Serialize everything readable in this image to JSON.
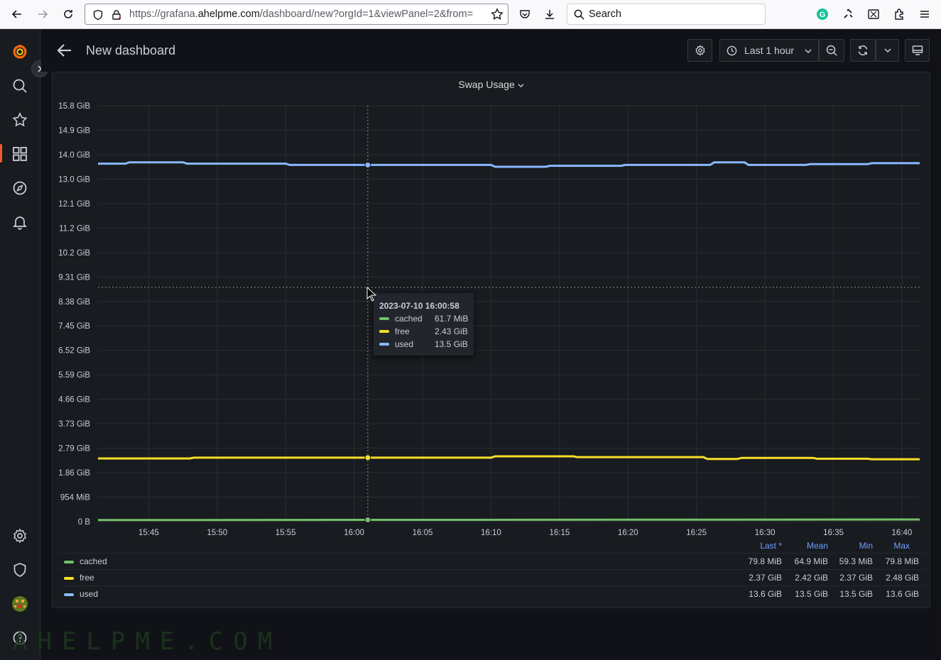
{
  "browser": {
    "url_prefix": "https://grafana.",
    "url_host": "ahelpme.com",
    "url_path": "/dashboard/new?orgId=1&viewPanel=2&from=",
    "search_label": "Search"
  },
  "dashboard": {
    "title": "New dashboard",
    "time_range_label": "Last 1 hour"
  },
  "panel": {
    "title": "Swap Usage"
  },
  "tooltip": {
    "time": "2023-07-10 16:00:58",
    "rows": [
      {
        "name": "cached",
        "value": "61.7 MiB",
        "color": "#73bf69"
      },
      {
        "name": "free",
        "value": "2.43 GiB",
        "color": "#fade2a"
      },
      {
        "name": "used",
        "value": "13.5 GiB",
        "color": "#8ab8ff"
      }
    ]
  },
  "legend": {
    "headers": [
      "Last *",
      "Mean",
      "Min",
      "Max"
    ],
    "rows": [
      {
        "name": "cached",
        "color": "#73bf69",
        "last": "79.8 MiB",
        "mean": "64.9 MiB",
        "min": "59.3 MiB",
        "max": "79.8 MiB"
      },
      {
        "name": "free",
        "color": "#fade2a",
        "last": "2.37 GiB",
        "mean": "2.42 GiB",
        "min": "2.37 GiB",
        "max": "2.48 GiB"
      },
      {
        "name": "used",
        "color": "#8ab8ff",
        "last": "13.6 GiB",
        "mean": "13.5 GiB",
        "min": "13.5 GiB",
        "max": "13.6 GiB"
      }
    ]
  },
  "chart_data": {
    "type": "line",
    "title": "Swap Usage",
    "y_ticks": [
      "0 B",
      "954 MiB",
      "1.86 GiB",
      "2.79 GiB",
      "3.73 GiB",
      "4.66 GiB",
      "5.59 GiB",
      "6.52 GiB",
      "7.45 GiB",
      "8.38 GiB",
      "9.31 GiB",
      "10.2 GiB",
      "11.2 GiB",
      "12.1 GiB",
      "13.0 GiB",
      "14.0 GiB",
      "14.9 GiB",
      "15.8 GiB"
    ],
    "ylim_gib": [
      0,
      15.8
    ],
    "x_ticks": [
      "15:45",
      "15:50",
      "15:55",
      "16:00",
      "16:05",
      "16:10",
      "16:15",
      "16:20",
      "16:25",
      "16:30",
      "16:35",
      "16:40"
    ],
    "x_tick_minutes": [
      45,
      50,
      55,
      60,
      65,
      70,
      75,
      80,
      85,
      90,
      95,
      100
    ],
    "xlim_minutes": [
      41.3,
      101.3
    ],
    "cursor_minute": 61,
    "series": [
      {
        "name": "cached",
        "color": "#73bf69",
        "x": [
          41.3,
          101.3
        ],
        "y": [
          0.06,
          0.08
        ]
      },
      {
        "name": "free",
        "color": "#fade2a",
        "x": [
          41.3,
          48,
          48.3,
          61,
          70,
          70.3,
          76,
          76.3,
          85.5,
          85.8,
          88,
          88.3,
          93.5,
          93.8,
          97.5,
          97.8,
          101.3
        ],
        "y": [
          2.4,
          2.4,
          2.43,
          2.43,
          2.43,
          2.48,
          2.48,
          2.45,
          2.45,
          2.38,
          2.38,
          2.42,
          2.42,
          2.39,
          2.39,
          2.37,
          2.37
        ]
      },
      {
        "name": "used",
        "color": "#8ab8ff",
        "x": [
          41.3,
          43.3,
          43.6,
          47.5,
          47.8,
          55,
          55.3,
          70,
          70.3,
          74,
          74.3,
          79.5,
          79.8,
          86,
          86.3,
          88.5,
          88.8,
          93,
          93.3,
          97.5,
          97.8,
          101.3
        ],
        "y": [
          13.6,
          13.6,
          13.65,
          13.65,
          13.6,
          13.6,
          13.55,
          13.55,
          13.48,
          13.48,
          13.52,
          13.52,
          13.55,
          13.55,
          13.65,
          13.65,
          13.55,
          13.55,
          13.58,
          13.58,
          13.62,
          13.62
        ]
      }
    ]
  }
}
